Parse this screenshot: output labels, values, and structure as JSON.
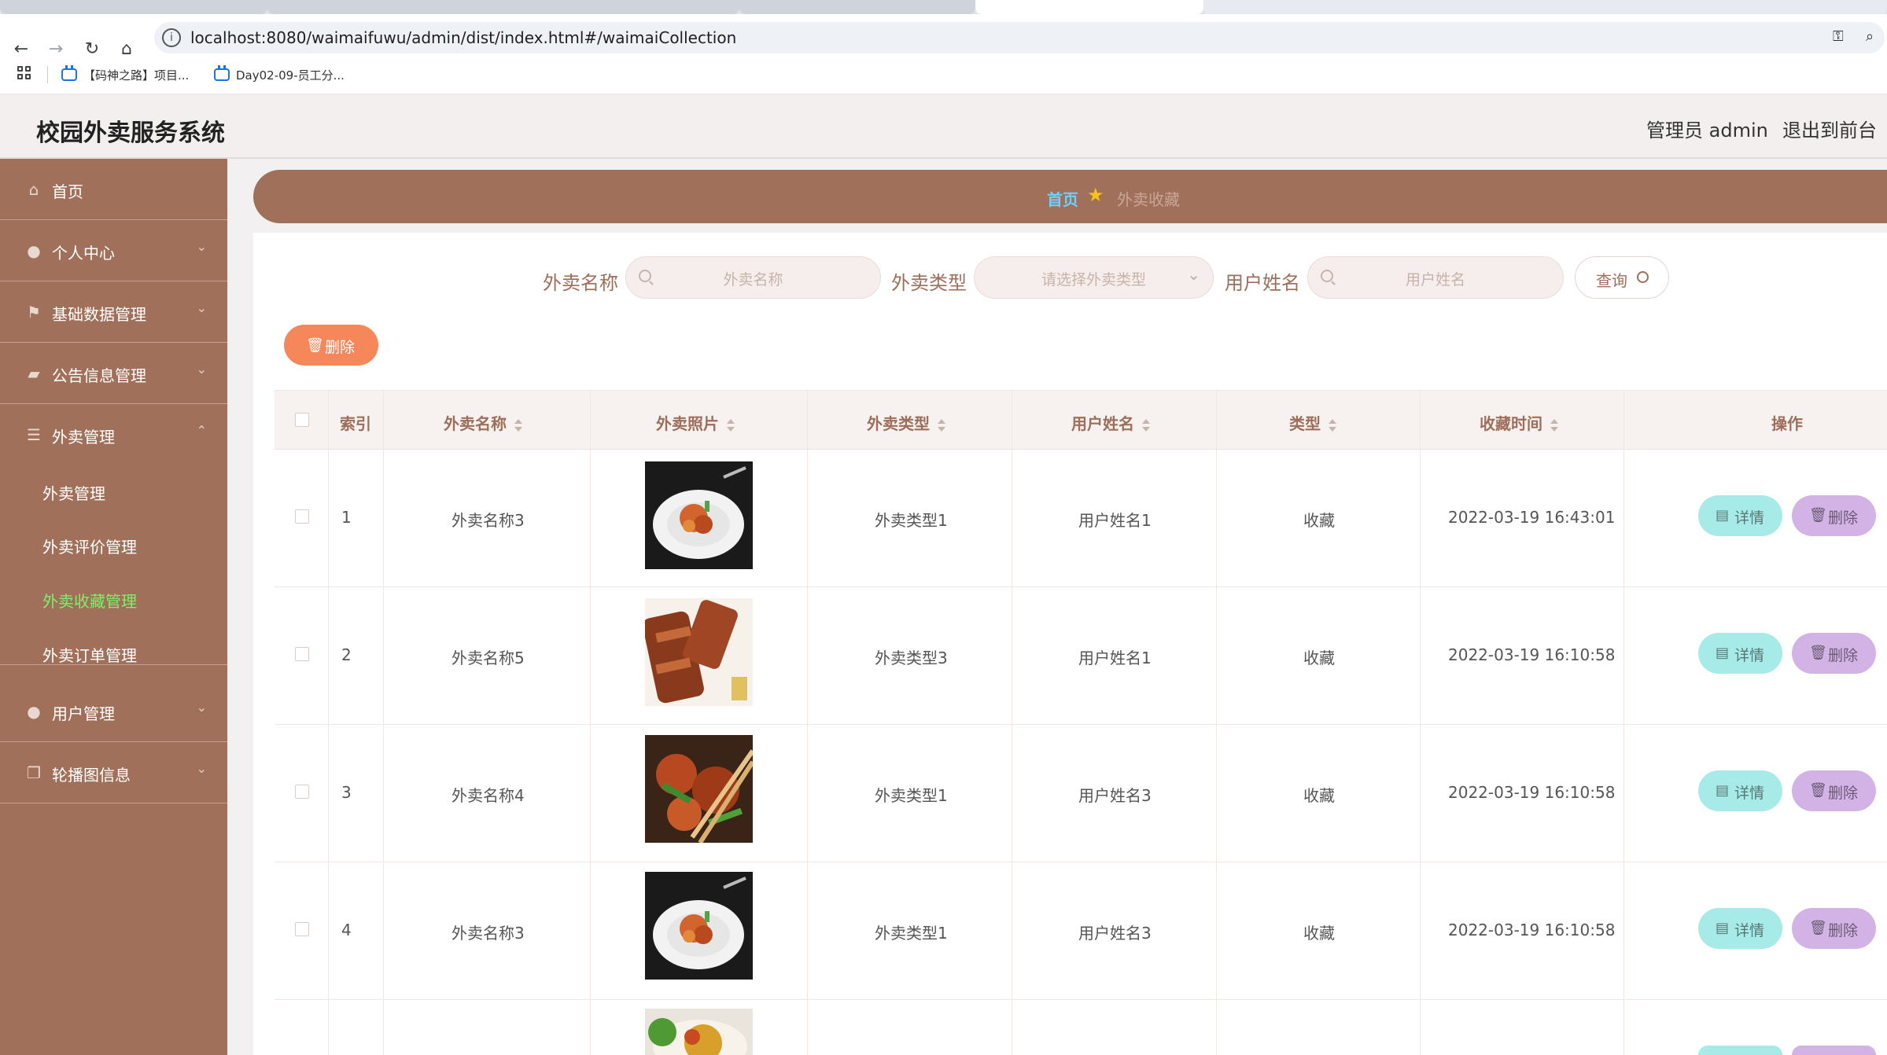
{
  "browser": {
    "url": "localhost:8080/waimaifuwu/admin/dist/index.html#/waimaiCollection",
    "bookmarks": [
      "【码神之路】项目...",
      "Day02-09-员工分..."
    ]
  },
  "header": {
    "title": "校园外卖服务系统",
    "admin_label": "管理员 admin",
    "exit_label": "退出到前台"
  },
  "sidebar": {
    "items": [
      {
        "label": "首页",
        "icon": "home-icon"
      },
      {
        "label": "个人中心",
        "icon": "user-icon"
      },
      {
        "label": "基础数据管理",
        "icon": "flag-icon"
      },
      {
        "label": "公告信息管理",
        "icon": "notice-icon"
      },
      {
        "label": "外卖管理",
        "icon": "sliders-icon"
      },
      {
        "label": "用户管理",
        "icon": "user-icon"
      },
      {
        "label": "轮播图信息",
        "icon": "copy-icon"
      }
    ],
    "submenu": [
      "外卖管理",
      "外卖评价管理",
      "外卖收藏管理",
      "外卖订单管理"
    ],
    "active_submenu": "外卖收藏管理"
  },
  "breadcrumb": {
    "home": "首页",
    "current": "外卖收藏"
  },
  "filters": {
    "name_label": "外卖名称",
    "name_placeholder": "外卖名称",
    "type_label": "外卖类型",
    "type_placeholder": "请选择外卖类型",
    "user_label": "用户姓名",
    "user_placeholder": "用户姓名",
    "query_label": "查询"
  },
  "bulk_delete_label": "删除",
  "table": {
    "headers": [
      "索引",
      "外卖名称",
      "外卖照片",
      "外卖类型",
      "用户姓名",
      "类型",
      "收藏时间",
      "操作"
    ],
    "rows": [
      {
        "index": "1",
        "name": "外卖名称3",
        "type": "外卖类型1",
        "user": "用户姓名1",
        "kind": "收藏",
        "time": "2022-03-19 16:43:01",
        "photo": "plated-dish"
      },
      {
        "index": "2",
        "name": "外卖名称5",
        "type": "外卖类型3",
        "user": "用户姓名1",
        "kind": "收藏",
        "time": "2022-03-19 16:10:58",
        "photo": "roast-meat"
      },
      {
        "index": "3",
        "name": "外卖名称4",
        "type": "外卖类型1",
        "user": "用户姓名3",
        "kind": "收藏",
        "time": "2022-03-19 16:10:58",
        "photo": "stir-fry"
      },
      {
        "index": "4",
        "name": "外卖名称3",
        "type": "外卖类型1",
        "user": "用户姓名3",
        "kind": "收藏",
        "time": "2022-03-19 16:10:58",
        "photo": "plated-dish"
      }
    ],
    "detail_label": "详情",
    "delete_label": "删除"
  },
  "colors": {
    "brand": "#a0705a",
    "active_menu": "#7cf16b",
    "bulk_delete": "#f5875a",
    "detail_button": "#a6ebe8",
    "delete_button": "#d3b2e6"
  }
}
